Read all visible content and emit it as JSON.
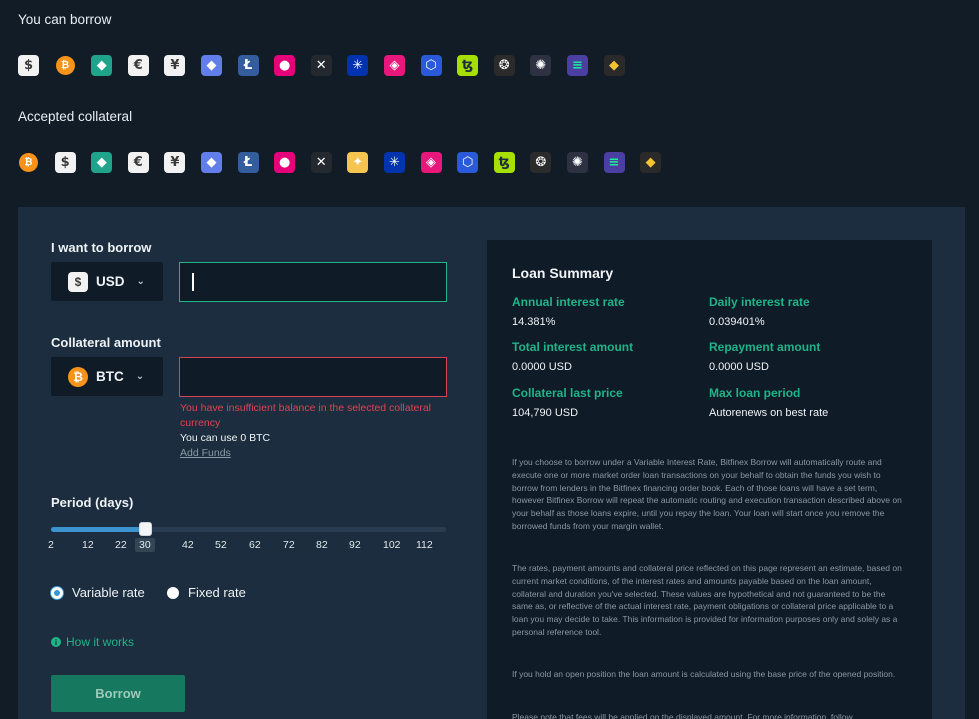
{
  "borrow_section": {
    "title": "You can borrow",
    "coins": [
      {
        "icon": "usd-icon",
        "glyph": "$",
        "bg": "#f2f2f2",
        "fg": "#3a3a3a"
      },
      {
        "icon": "btc-icon",
        "glyph": "₿",
        "bg": "#f7931a",
        "fg": "#ffffff",
        "round": true
      },
      {
        "icon": "tether-gold-icon",
        "glyph": "◆",
        "bg": "#1fa38a",
        "fg": "#ffffff"
      },
      {
        "icon": "eur-icon",
        "glyph": "€",
        "bg": "#f2f2f2",
        "fg": "#3a3a3a"
      },
      {
        "icon": "jpy-icon",
        "glyph": "¥",
        "bg": "#f2f2f2",
        "fg": "#3a3a3a"
      },
      {
        "icon": "eth-icon",
        "glyph": "◆",
        "bg": "#627eea",
        "fg": "#ffffff"
      },
      {
        "icon": "ltc-icon",
        "glyph": "Ł",
        "bg": "#345d9d",
        "fg": "#ffffff"
      },
      {
        "icon": "dot-icon",
        "glyph": "●",
        "bg": "#e6007a",
        "fg": "#ffffff"
      },
      {
        "icon": "xrp-icon",
        "glyph": "✕",
        "bg": "#23292f",
        "fg": "#ffffff"
      },
      {
        "icon": "ada-icon",
        "glyph": "✳",
        "bg": "#0033ad",
        "fg": "#ffffff"
      },
      {
        "icon": "matic-icon",
        "glyph": "◈",
        "bg": "#e8177c",
        "fg": "#ffffff"
      },
      {
        "icon": "link-icon",
        "glyph": "⬡",
        "bg": "#2a5ada",
        "fg": "#ffffff"
      },
      {
        "icon": "xtz-icon",
        "glyph": "ꜩ",
        "bg": "#a6e000",
        "fg": "#1b2d3e"
      },
      {
        "icon": "iota-icon",
        "glyph": "❂",
        "bg": "#2b2b2b",
        "fg": "#ffffff"
      },
      {
        "icon": "neo-icon",
        "glyph": "✺",
        "bg": "#2d3142",
        "fg": "#ffffff"
      },
      {
        "icon": "sol-icon",
        "glyph": "≡",
        "bg": "#4b3fa4",
        "fg": "#14f195"
      },
      {
        "icon": "leo-icon",
        "glyph": "◆",
        "bg": "#2a2a2a",
        "fg": "#f4c430"
      }
    ]
  },
  "collateral_section": {
    "title": "Accepted collateral",
    "coins": [
      {
        "icon": "btc-icon",
        "glyph": "₿",
        "bg": "#f7931a",
        "fg": "#ffffff",
        "round": true
      },
      {
        "icon": "usd-icon",
        "glyph": "$",
        "bg": "#f2f2f2",
        "fg": "#3a3a3a"
      },
      {
        "icon": "tether-gold-icon",
        "glyph": "◆",
        "bg": "#1fa38a",
        "fg": "#ffffff"
      },
      {
        "icon": "eur-icon",
        "glyph": "€",
        "bg": "#f2f2f2",
        "fg": "#3a3a3a"
      },
      {
        "icon": "jpy-icon",
        "glyph": "¥",
        "bg": "#f2f2f2",
        "fg": "#3a3a3a"
      },
      {
        "icon": "eth-icon",
        "glyph": "◆",
        "bg": "#627eea",
        "fg": "#ffffff"
      },
      {
        "icon": "ltc-icon",
        "glyph": "Ł",
        "bg": "#345d9d",
        "fg": "#ffffff"
      },
      {
        "icon": "dot-icon",
        "glyph": "●",
        "bg": "#e6007a",
        "fg": "#ffffff"
      },
      {
        "icon": "xrp-icon",
        "glyph": "✕",
        "bg": "#23292f",
        "fg": "#ffffff"
      },
      {
        "icon": "avax-icon",
        "glyph": "✦",
        "bg": "#f5c451",
        "fg": "#ffffff"
      },
      {
        "icon": "ada-icon",
        "glyph": "✳",
        "bg": "#0033ad",
        "fg": "#ffffff"
      },
      {
        "icon": "matic-icon",
        "glyph": "◈",
        "bg": "#e8177c",
        "fg": "#ffffff"
      },
      {
        "icon": "link-icon",
        "glyph": "⬡",
        "bg": "#2a5ada",
        "fg": "#ffffff"
      },
      {
        "icon": "xtz-icon",
        "glyph": "ꜩ",
        "bg": "#a6e000",
        "fg": "#1b2d3e"
      },
      {
        "icon": "iota-icon",
        "glyph": "❂",
        "bg": "#2b2b2b",
        "fg": "#ffffff"
      },
      {
        "icon": "neo-icon",
        "glyph": "✺",
        "bg": "#2d3142",
        "fg": "#ffffff"
      },
      {
        "icon": "sol-icon",
        "glyph": "≡",
        "bg": "#4b3fa4",
        "fg": "#14f195"
      },
      {
        "icon": "leo-icon",
        "glyph": "◆",
        "bg": "#2a2a2a",
        "fg": "#f4c430"
      }
    ]
  },
  "form": {
    "borrow_label": "I want to borrow",
    "borrow_currency": {
      "code": "USD",
      "glyph": "$"
    },
    "borrow_amount": "",
    "collateral_label": "Collateral amount",
    "collateral_currency": {
      "code": "BTC",
      "glyph": "₿"
    },
    "collateral_amount": "",
    "error_text": "You have insufficient balance in the selected collateral currency",
    "available_text": "You can use 0 BTC",
    "add_funds": "Add Funds",
    "period_label": "Period (days)",
    "period_value": 30,
    "period_ticks": [
      "2",
      "12",
      "22",
      "30",
      "42",
      "52",
      "62",
      "72",
      "82",
      "92",
      "102",
      "112"
    ],
    "rate_options": [
      {
        "label": "Variable rate",
        "checked": true
      },
      {
        "label": "Fixed rate",
        "checked": false
      }
    ],
    "how_it_works": "How it works",
    "borrow_button": "Borrow"
  },
  "summary": {
    "title": "Loan Summary",
    "items": [
      {
        "key": "Annual interest rate",
        "value": "14.381%"
      },
      {
        "key": "Daily interest rate",
        "value": "0.039401%"
      },
      {
        "key": "Total interest amount",
        "value": "0.0000 USD"
      },
      {
        "key": "Repayment amount",
        "value": "0.0000 USD"
      },
      {
        "key": "Collateral last price",
        "value": "104,790 USD"
      },
      {
        "key": "Max loan period",
        "value": "Autorenews on best rate"
      }
    ],
    "disclaimers": [
      "If you choose to borrow under a Variable Interest Rate, Bitfinex Borrow will automatically route and execute one or more market order loan transactions on your behalf to obtain the funds you wish to borrow from lenders in the Bitfinex financing order book. Each of those loans will have a set term, however Bitfinex Borrow will repeat the automatic routing and execution transaction described above on your behalf as those loans expire, until you repay the loan. Your loan will start once you remove the borrowed funds from your margin wallet.",
      "The rates, payment amounts and collateral price reflected on this page represent an estimate, based on current market conditions, of the interest rates and amounts payable based on the loan amount, collateral and duration you've selected. These values are hypothetical and not guaranteed to be the same as, or reflective of the actual interest rate, payment obligations or collateral price applicable to a loan you may decide to take. This information is provided for information purposes only and solely as a personal reference tool.",
      "If you hold an open position the loan amount is calculated using the base price of the opened position.",
      "Please note that fees will be applied on the displayed amount. For more information, follow"
    ]
  }
}
